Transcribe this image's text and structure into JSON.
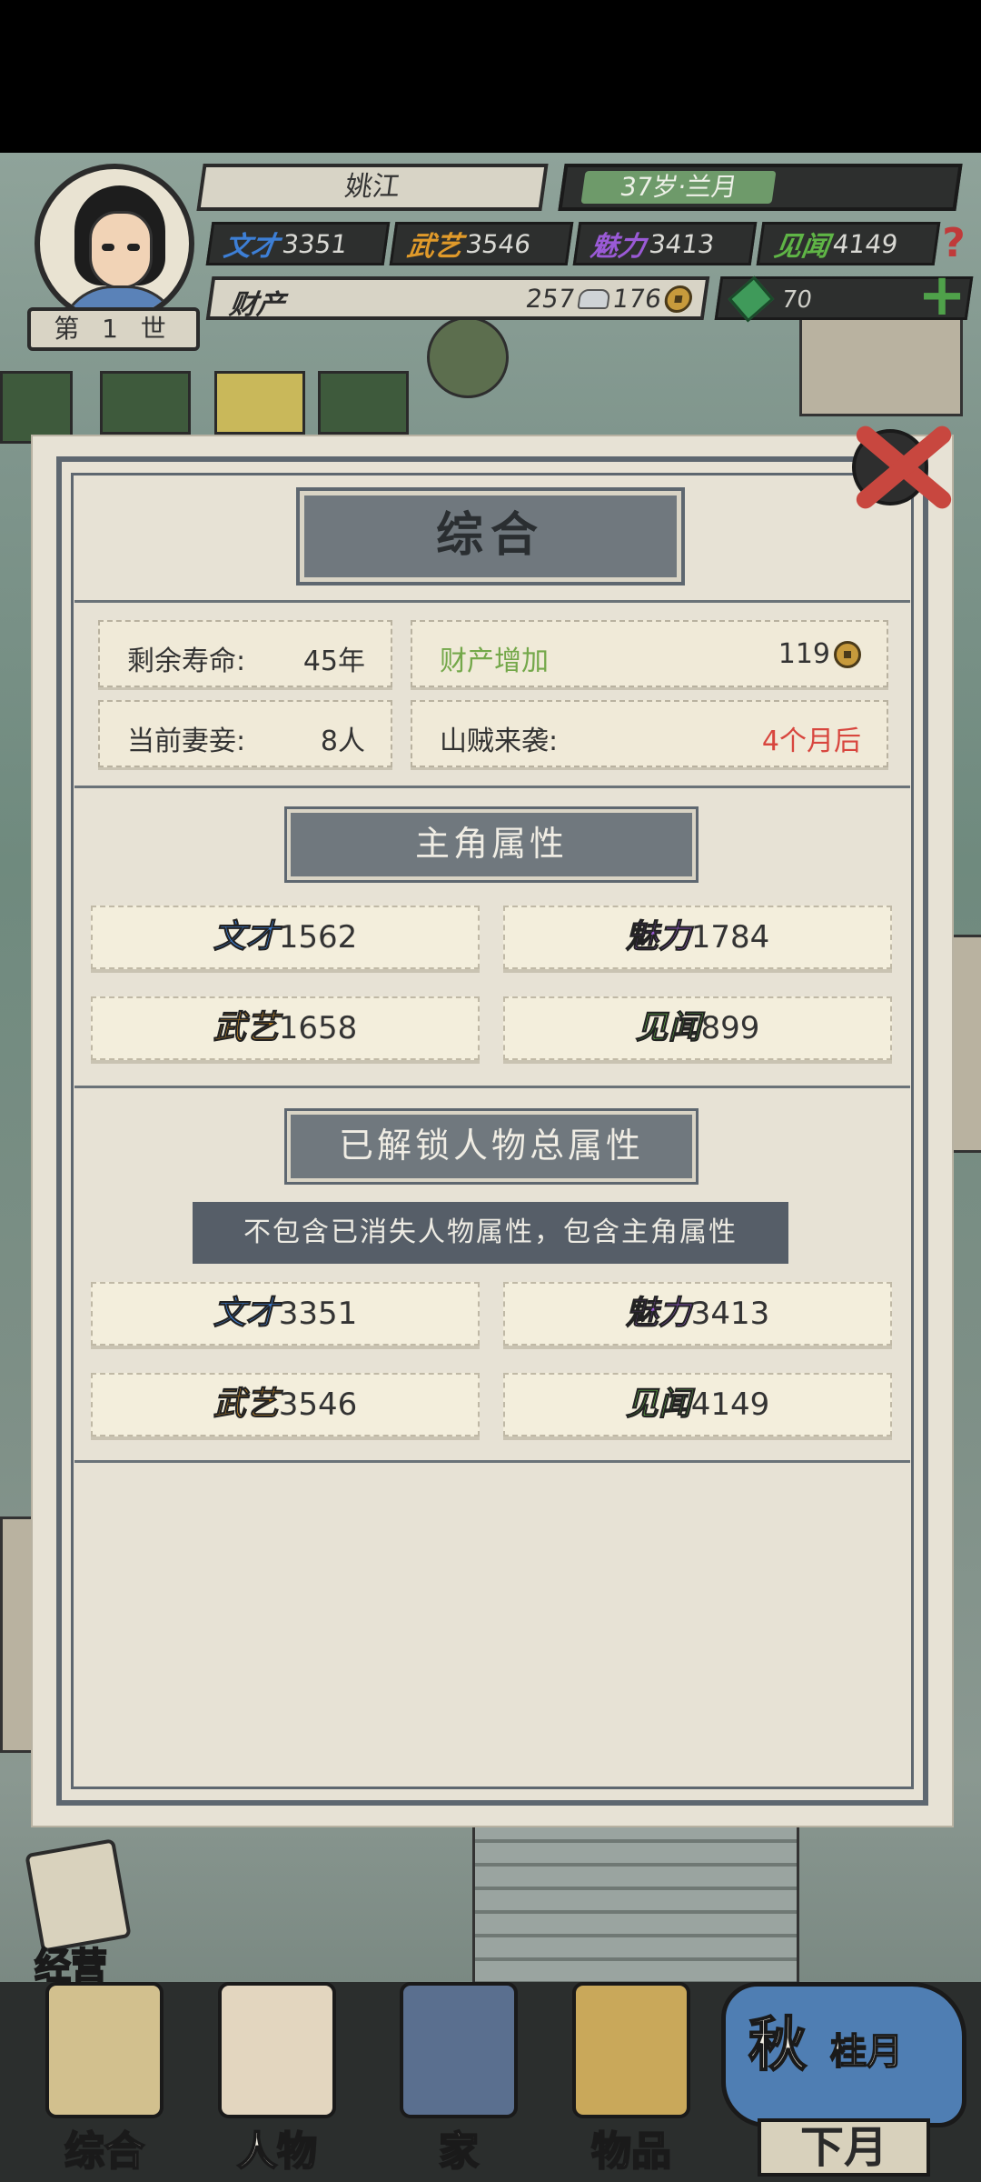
{
  "header": {
    "generation": "第 1 世",
    "name": "姚江",
    "age_month": "37岁·兰月",
    "stats": [
      {
        "label": "文才",
        "value": "3351",
        "color": "#3d7fd6"
      },
      {
        "label": "武艺",
        "value": "3546",
        "color": "#e09a2a"
      },
      {
        "label": "魅力",
        "value": "3413",
        "color": "#9a5ad6"
      },
      {
        "label": "见闻",
        "value": "4149",
        "color": "#5fb546"
      }
    ],
    "wealth_label": "财产",
    "silver": "257",
    "copper": "176",
    "jade": "70"
  },
  "panel": {
    "title": "综合",
    "info": {
      "lifespan_label": "剩余寿命:",
      "lifespan_value": "45年",
      "wealth_gain_label": "财产增加",
      "wealth_gain_value": "119",
      "spouses_label": "当前妻妾:",
      "spouses_value": "8人",
      "bandits_label": "山贼来袭:",
      "bandits_value": "4个月后"
    },
    "hero_section_title": "主角属性",
    "hero_attrs": {
      "wen": {
        "label": "文才",
        "value": "1562"
      },
      "mei": {
        "label": "魅力",
        "value": "1784"
      },
      "wu": {
        "label": "武艺",
        "value": "1658"
      },
      "jian": {
        "label": "见闻",
        "value": "899"
      }
    },
    "total_section_title": "已解锁人物总属性",
    "total_note": "不包含已消失人物属性，包含主角属性",
    "total_attrs": {
      "wen": {
        "label": "文才",
        "value": "3351"
      },
      "mei": {
        "label": "魅力",
        "value": "3413"
      },
      "wu": {
        "label": "武艺",
        "value": "3546"
      },
      "jian": {
        "label": "见闻",
        "value": "4149"
      }
    }
  },
  "bottom": {
    "manage_label": "经营",
    "nav": [
      "综合",
      "人物",
      "家",
      "物品"
    ],
    "season": "秋",
    "month": "桂月",
    "next_month": "下月"
  },
  "icons": {
    "help": "question-icon",
    "add": "plus-icon",
    "close": "close-icon",
    "coin": "copper-coin-icon",
    "silver": "silver-ingot-icon",
    "jade": "jade-icon"
  }
}
